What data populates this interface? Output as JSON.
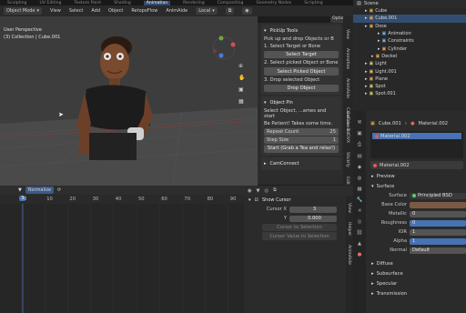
{
  "top_tabs": [
    "Sculpting",
    "UV Editing",
    "Texture Paint",
    "Shading",
    "Animation",
    "Rendering",
    "Compositing",
    "Geometry Nodes",
    "Scripting"
  ],
  "top_active": "Animation",
  "header": {
    "mode": "Object Mode",
    "view": "View",
    "select": "Select",
    "add": "Add",
    "object": "Object",
    "retopoflow": "RetopoFlow",
    "animaide": "AnimAide",
    "local": "Local",
    "options": "Options"
  },
  "viewport": {
    "line1": "User Perspective",
    "line2": "(3) Collection | Cube.001"
  },
  "vtabs1": [
    "View",
    "Animation",
    "AnimAide",
    "CamConnect"
  ],
  "vtabs2": [
    "Collider To DVX",
    "Stickify",
    "Edit"
  ],
  "npanel": {
    "pickup": {
      "title": "PickUp Tools",
      "desc": "Pick up and drop Objects or B",
      "s1": "1. Select Target or Bone",
      "b1": "Select Target",
      "s2": "2. Select picked Object or Bone",
      "b2": "Select Picked Object",
      "s3": "3. Drop selected Object",
      "b3": "Drop Object"
    },
    "pin": {
      "title": "Object Pin",
      "d1": "Select Object, ...ames and start",
      "d2": "Be Patient! Takes some time.",
      "rc_label": "Repeat Count",
      "rc_val": "25",
      "ss_label": "Step Size",
      "ss_val": "1",
      "start": "Start (Grab a Tea and relax!)"
    },
    "cam": {
      "title": "CamConnect"
    }
  },
  "timeline": {
    "normalize": "Normalize",
    "current": "3",
    "ticks": [
      "0",
      "10",
      "20",
      "30",
      "40",
      "50",
      "60",
      "70",
      "80",
      "90",
      "100"
    ]
  },
  "cursor": {
    "title": "Show Cursor",
    "x_label": "Cursor X",
    "x_val": "3",
    "y_label": "Y",
    "y_val": "0.000",
    "b1": "Cursor to Selection",
    "b2": "Cursor Value to Selection"
  },
  "vtabs3": [
    "View",
    "Helper",
    "AnimAide"
  ],
  "outliner": {
    "title": "Scene",
    "items": [
      {
        "name": "Cube",
        "indent": 1,
        "color": "#e2a44c"
      },
      {
        "name": "Cube.001",
        "indent": 1,
        "color": "#e2a44c",
        "selected": true
      },
      {
        "name": "Dose",
        "indent": 1,
        "color": "#e2a44c"
      },
      {
        "name": "Animation",
        "indent": 3,
        "color": "#7ab0e0"
      },
      {
        "name": "Constraints",
        "indent": 3,
        "color": "#7ab0e0"
      },
      {
        "name": "Cylinder",
        "indent": 3,
        "color": "#e2a44c"
      },
      {
        "name": "Deckel",
        "indent": 2,
        "color": "#e2a44c"
      },
      {
        "name": "Light",
        "indent": 1,
        "color": "#d9c26a"
      },
      {
        "name": "Light.001",
        "indent": 1,
        "color": "#d9c26a"
      },
      {
        "name": "Plane",
        "indent": 1,
        "color": "#e2a44c"
      },
      {
        "name": "Spot",
        "indent": 1,
        "color": "#d9c26a"
      },
      {
        "name": "Spot.001",
        "indent": 1,
        "color": "#d9c26a"
      }
    ]
  },
  "props": {
    "object": "Cube.001",
    "material_top": "Material.002",
    "slot": "Material.002",
    "material_name": "Material.002",
    "preview": "Preview",
    "surface_sect": "Surface",
    "surface_label": "Surface",
    "surface_val": "Principled BSD",
    "fields": [
      {
        "label": "Base Color",
        "val": ""
      },
      {
        "label": "Metallic",
        "val": "0"
      },
      {
        "label": "Roughness",
        "val": "0"
      },
      {
        "label": "IOR",
        "val": "1"
      },
      {
        "label": "Alpha",
        "val": "1"
      },
      {
        "label": "Normal",
        "val": "Default"
      }
    ],
    "sections": [
      "Diffuse",
      "Subsurface",
      "Specular",
      "Transmission"
    ]
  }
}
